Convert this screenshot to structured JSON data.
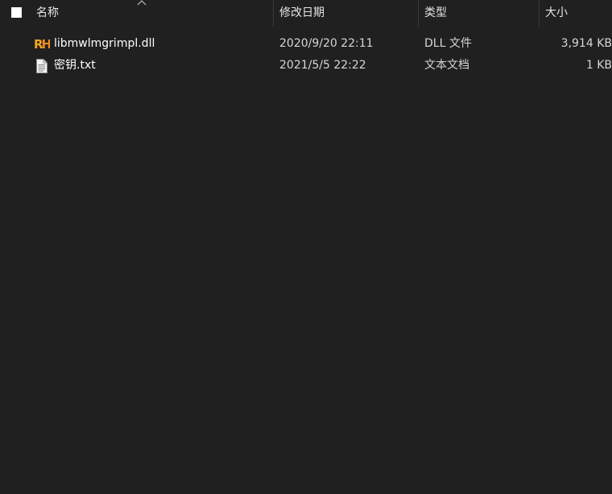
{
  "columns": {
    "name": "名称",
    "modified": "修改日期",
    "type": "类型",
    "size": "大小"
  },
  "files": [
    {
      "icon": "dll-file-icon",
      "name": "libmwlmgrimpl.dll",
      "modified": "2020/9/20 22:11",
      "type": "DLL 文件",
      "size": "3,914 KB"
    },
    {
      "icon": "text-file-icon",
      "name": "密钥.txt",
      "modified": "2021/5/5 22:22",
      "type": "文本文档",
      "size": "1 KB"
    }
  ],
  "colors": {
    "background": "#202020",
    "text": "#ffffff",
    "dll_icon": "#f5a623"
  }
}
